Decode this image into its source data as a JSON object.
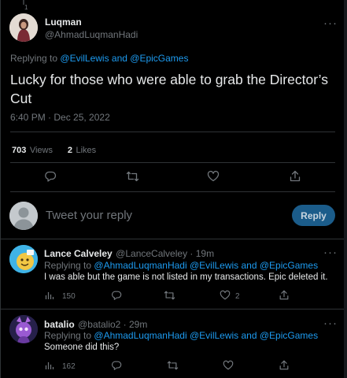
{
  "main_tweet": {
    "thread_marker": "1",
    "author_name": "Luqman",
    "author_handle": "@AhmadLuqmanHadi",
    "replying_prefix": "Replying to",
    "replying_to": "@EvilLewis and @EpicGames",
    "text": "Lucky for those who were able to grab the Director’s Cut",
    "timestamp": "6:40 PM · Dec 25, 2022",
    "views_count": "703",
    "views_label": "Views",
    "likes_count": "2",
    "likes_label": "Likes",
    "more_label": "···"
  },
  "reply_box": {
    "placeholder": "Tweet your reply",
    "button_label": "Reply"
  },
  "replies": [
    {
      "author_name": "Lance Calveley",
      "author_handle": "@LanceCalveley · 19m",
      "replying_prefix": "Replying to",
      "replying_to": "@AhmadLuqmanHadi @EvilLewis and @EpicGames",
      "text": "I was able but the game is not listed in my transactions. Epic deleted it.",
      "views": "150",
      "likes": "2",
      "more_label": "···"
    },
    {
      "author_name": "batalio",
      "author_handle": "@batalio2 · 29m",
      "replying_prefix": "Replying to",
      "replying_to": "@AhmadLuqmanHadi @EvilLewis and @EpicGames",
      "text": "Someone did this?",
      "views": "162",
      "more_label": "···"
    }
  ],
  "colors": {
    "background": "#000000",
    "link": "#1d9bf0",
    "muted": "#71767b",
    "text": "#e7e9ea",
    "reply_button": "#1b5c8a"
  },
  "icons": [
    "more-icon",
    "reply-icon",
    "retweet-icon",
    "like-icon",
    "share-icon",
    "views-icon"
  ]
}
